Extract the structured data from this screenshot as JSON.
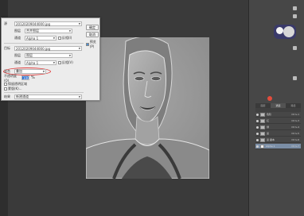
{
  "dialog": {
    "source_label": "源",
    "source_value": "20120209044000.jpg",
    "layer1_label": "图层",
    "layer1_value": "合并图层",
    "channel1_label": "通道",
    "channel1_value": "Alpha 1",
    "invert1_label": "反相(I)",
    "target_label": "目标",
    "target_value": "20120209044000.jpg",
    "layer2_label": "图层",
    "layer2_value": "图层",
    "channel2_label": "通道",
    "channel2_value": "Alpha 1",
    "invert2_label": "反相(V)",
    "blend_label": "混合",
    "blend_value": "叠加",
    "opacity_label": "不透明度(O)",
    "opacity_value": "100",
    "opacity_unit": "%",
    "preserve_label": "保留透明区域",
    "mask_label": "蒙版(K)...",
    "result_label": "结果",
    "result_value": "新建通道",
    "ok_label": "确定",
    "cancel_label": "取消",
    "preview_label": "预览(P)"
  },
  "layers_panel": {
    "tabs": [
      "图层",
      "通道",
      "路径"
    ],
    "layers": [
      {
        "name": "色阶",
        "ctrl": "Ctrl+1"
      },
      {
        "name": "红",
        "ctrl": "Ctrl+3"
      },
      {
        "name": "绿",
        "ctrl": "Ctrl+4"
      },
      {
        "name": "蓝",
        "ctrl": "Ctrl+5"
      },
      {
        "name": "蓝 副本",
        "ctrl": "Ctrl+6"
      },
      {
        "name": "Alpha 1",
        "ctrl": "Ctrl+7"
      }
    ]
  },
  "colors": {
    "highlight": "#e03b3b",
    "selected_layer": "#7b8ea6"
  }
}
